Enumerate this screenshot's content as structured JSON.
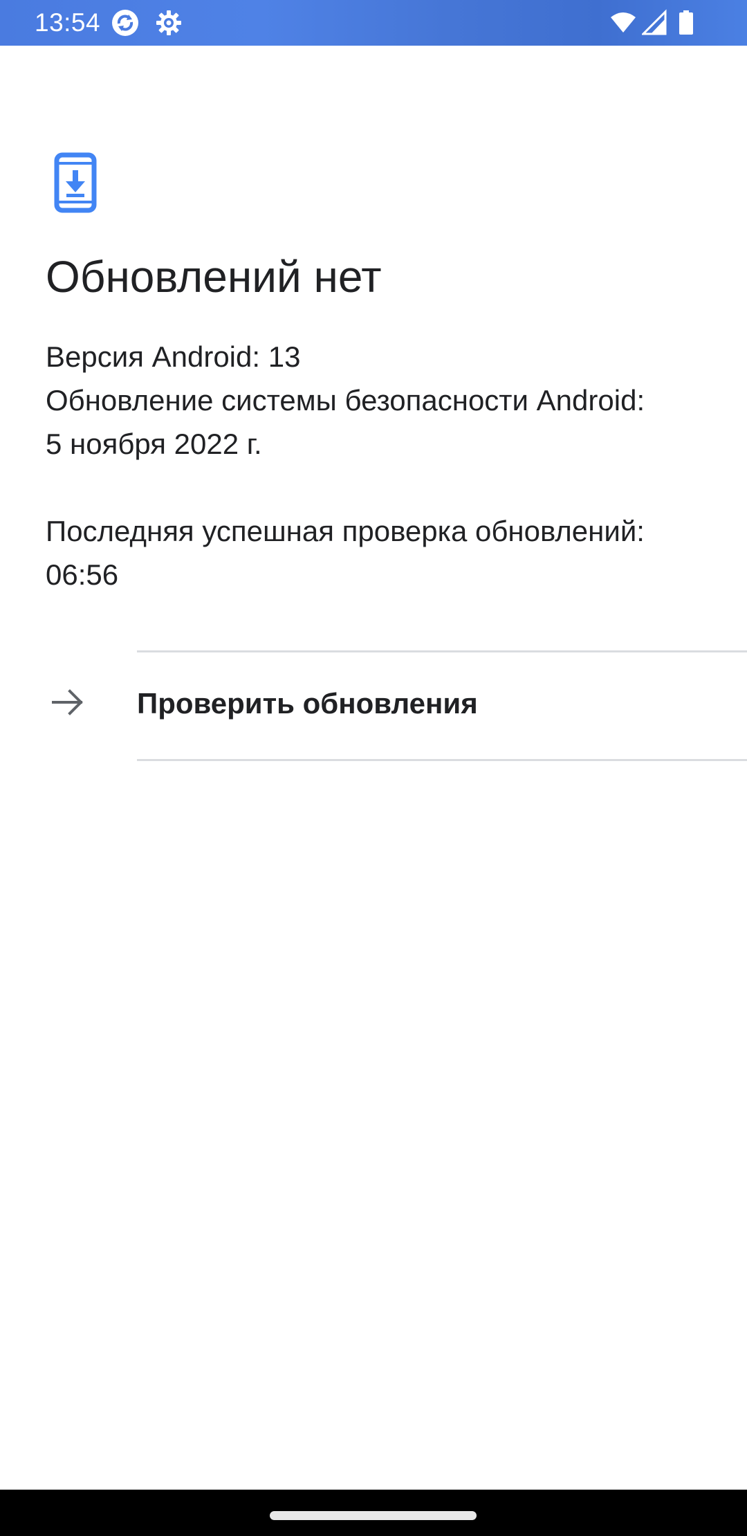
{
  "status_bar": {
    "time": "13:54",
    "left_icons": [
      "sync-notification-icon",
      "settings-gear-icon"
    ],
    "right_icons": [
      "wifi-icon",
      "cellular-signal-icon",
      "battery-icon"
    ]
  },
  "header": {
    "icon": "phone-download-icon",
    "icon_color": "#4285f4",
    "title": "Обновлений нет"
  },
  "info": {
    "android_version": "Версия Android: 13",
    "security_update_label": "Обновление системы безопасности Android:",
    "security_update_date": "5 ноября 2022 г.",
    "last_check_label": "Последняя успешная проверка обновлений:",
    "last_check_time": "06:56"
  },
  "action": {
    "icon": "arrow-right-icon",
    "label": "Проверить обновления"
  },
  "nav_bar": {
    "handle": "home-gesture-handle"
  }
}
